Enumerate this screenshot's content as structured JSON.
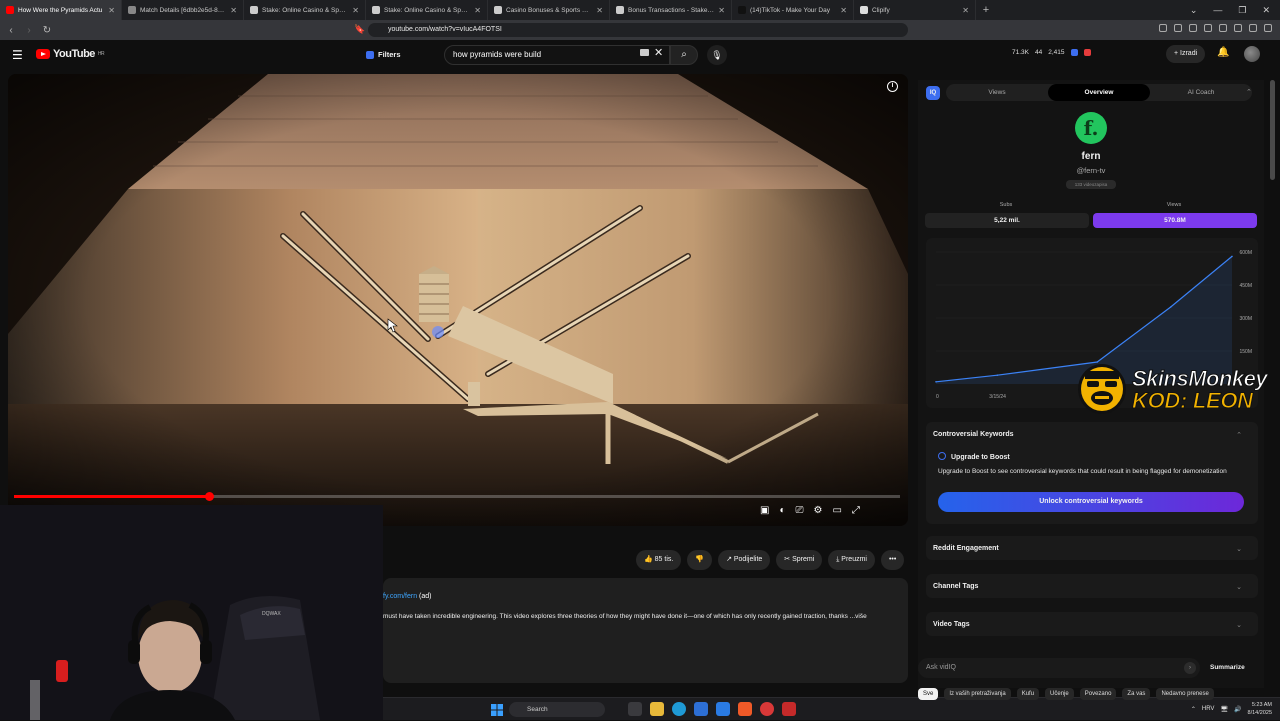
{
  "browser": {
    "tabs": [
      {
        "title": "How Were the Pyramids Actu",
        "favicon_color": "#ff0000",
        "active": true
      },
      {
        "title": "Match Details [6dbb2e5d-8670-44d",
        "favicon_color": "#888888",
        "active": false
      },
      {
        "title": "Stake: Online Casino & Sports Bettin",
        "favicon_color": "#cccccc",
        "active": false
      },
      {
        "title": "Stake: Online Casino & Sports Bettin",
        "favicon_color": "#cccccc",
        "active": false
      },
      {
        "title": "Casino Bonuses & Sports Betting Pr",
        "favicon_color": "#cccccc",
        "active": false
      },
      {
        "title": "Bonus Transactions - Stake.com",
        "favicon_color": "#cccccc",
        "active": false
      },
      {
        "title": "(14)TikTok - Make Your Day",
        "favicon_color": "#111111",
        "active": false
      },
      {
        "title": "Clipify",
        "favicon_color": "#dddddd",
        "active": false
      }
    ],
    "new_tab_glyph": "+",
    "window_controls": [
      "⌄",
      "—",
      "❐",
      "✕"
    ],
    "url": "youtube.com/watch?v=vIucA4FOTSI"
  },
  "youtube": {
    "logo_text": "YouTube",
    "logo_region": "HR",
    "filters_label": "Filters",
    "search_query": "how pyramids were build",
    "stats": [
      "71.3K",
      "44",
      "2,415"
    ],
    "create_label": "+ Izradi"
  },
  "video": {
    "progress": 0.222
  },
  "below_video": {
    "like_label": "👍 85 tis.",
    "dislike_label": "👎",
    "share_label": "↗ Podijelite",
    "save_label": "✂ Spremi",
    "download_label": "⤓ Preuzmi",
    "more_label": "•••",
    "desc_link": "fy.com/fern",
    "desc_ad": " (ad)",
    "desc_text": "must have taken incredible engineering. This video explores three theories of how they might have done it—one of which has only recently gained traction, thanks  ...više"
  },
  "panel": {
    "logo_label": "IQ",
    "tabs": [
      "Views",
      "Overview",
      "AI Coach"
    ],
    "active_tab": 1,
    "channel_initial": "f.",
    "channel_name": "fern",
    "channel_handle": "@fern-tv",
    "channel_videos": "133 videozapisa",
    "subs_label": "Subs",
    "subs_value": "5,22 mil.",
    "views_label": "Views",
    "views_value": "570.8M",
    "controversial_title": "Controversial Keywords",
    "upgrade_title": "Upgrade to Boost",
    "upgrade_desc": "Upgrade to Boost to see controversial keywords that could result in being flagged for demonetization",
    "unlock_label": "Unlock controversial keywords",
    "reddit_title": "Reddit Engagement",
    "channel_tags_title": "Channel Tags",
    "video_tags_title": "Video Tags",
    "ask_placeholder": "Ask vidIQ",
    "summarize_label": "Summarize",
    "chips": [
      "Sve",
      "Iz vaših pretraživanja",
      "Kufu",
      "Učenje",
      "Povezano",
      "Za vas",
      "Nedavno prenese"
    ]
  },
  "chart_data": {
    "type": "area",
    "x": [
      "2023-11-01",
      "2024-03-15",
      "2024-10-21",
      "2025-04-01",
      "2025-08-14"
    ],
    "values": [
      10,
      40,
      100,
      350,
      580
    ],
    "xtick_labels": [
      "0",
      "3/15/24",
      "10/21/24"
    ],
    "ytick_labels": [
      "600M",
      "450M",
      "300M",
      "150M"
    ],
    "ylim": [
      0,
      600
    ],
    "line_color": "#3b82f6"
  },
  "overlay": {
    "brand_line1": "SkinsMonkey",
    "brand_line2": "KOD: LEON"
  },
  "taskbar": {
    "search_label": "Search",
    "lang": "HRV",
    "time": "5:23 AM",
    "date": "8/14/2025"
  }
}
